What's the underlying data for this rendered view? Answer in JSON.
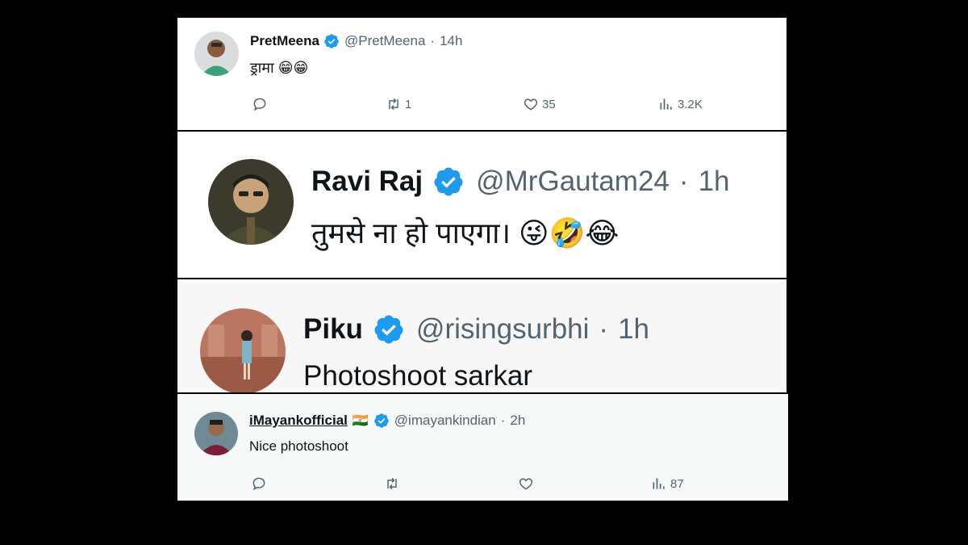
{
  "tweets": [
    {
      "name": "PretMeena",
      "handle": "@PretMeena",
      "sep": "·",
      "time": "14h",
      "text": "ड्रामा 😁😁",
      "replies": "",
      "retweets": "1",
      "likes": "35",
      "views": "3.2K"
    },
    {
      "name": "Ravi Raj",
      "handle": "@MrGautam24",
      "sep": "·",
      "time": "1h",
      "text": "तुमसे ना हो पाएगा। 😜🤣😂"
    },
    {
      "name": "Piku",
      "handle": "@risingsurbhi",
      "sep": "·",
      "time": "1h",
      "text": "Photoshoot sarkar"
    },
    {
      "name": "iMayankofficial",
      "flag": "🇮🇳",
      "handle": "@imayankindian",
      "sep": "·",
      "time": "2h",
      "text": "Nice photoshoot",
      "views": "87"
    }
  ],
  "colors": {
    "verified": "#1d9bf0",
    "muted": "#536471",
    "text": "#0f1419"
  }
}
